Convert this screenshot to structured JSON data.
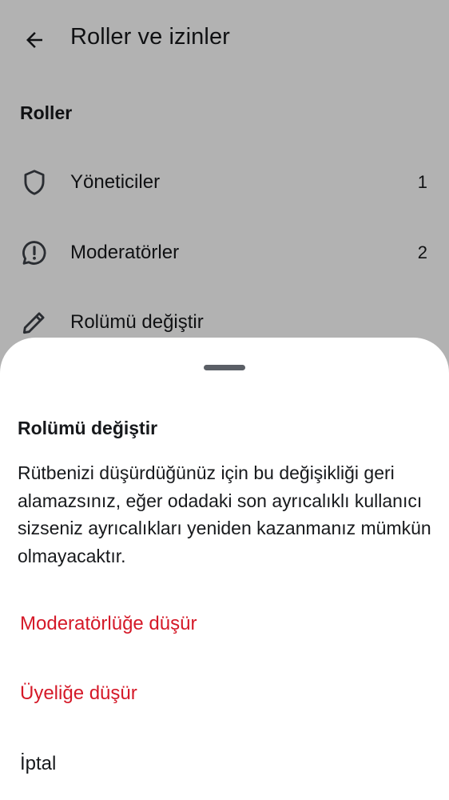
{
  "header": {
    "title": "Roller ve izinler",
    "back_icon": "arrow-left-icon"
  },
  "roles_section": {
    "title": "Roller",
    "items": [
      {
        "label": "Yöneticiler",
        "count": "1",
        "icon": "shield-icon"
      },
      {
        "label": "Moderatörler",
        "count": "2",
        "icon": "chat-alert-icon"
      },
      {
        "label": "Rolümü değiştir",
        "icon": "pencil-icon"
      }
    ]
  },
  "sheet": {
    "title": "Rolümü değiştir",
    "description": "Rütbenizi düşürdüğünüz için bu değişikliği geri alamazsınız, eğer odadaki son ayrıcalıklı kullanıcı sizseniz ayrıcalıkları yeniden kazanmanız mümkün olmayacaktır.",
    "actions": [
      {
        "label": "Moderatörlüğe düşür",
        "color": "#d51928"
      },
      {
        "label": "Üyeliğe düşür",
        "color": "#d51928"
      },
      {
        "label": "İptal",
        "color": "#17191c"
      }
    ]
  },
  "colors": {
    "danger": "#d51928",
    "text": "#17191c",
    "scrim": "rgba(0,0,0,0.30)"
  }
}
